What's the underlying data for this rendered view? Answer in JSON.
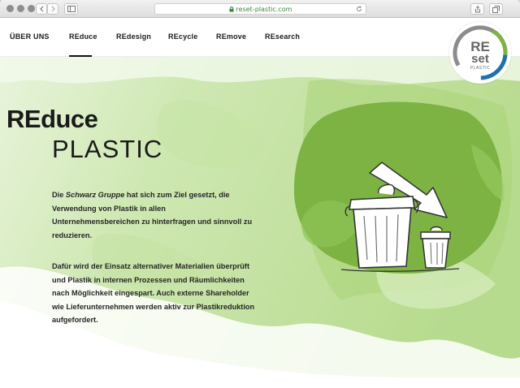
{
  "browser": {
    "url": "reset-plastic.com"
  },
  "nav": {
    "items": [
      {
        "label": "ÜBER UNS"
      },
      {
        "label": "REduce"
      },
      {
        "label": "REdesign"
      },
      {
        "label": "REcycle"
      },
      {
        "label": "REmove"
      },
      {
        "label": "REsearch"
      }
    ],
    "active": "REduce"
  },
  "logo": {
    "line1": "RE",
    "line2": "set",
    "line3": "PLASTIC"
  },
  "hero": {
    "title_bold": "REduce",
    "title_light": "PLASTIC",
    "p1_prefix": "Die ",
    "p1_emph": "Schwarz Gruppe",
    "p1_rest": " hat sich zum Ziel gesetzt, die Verwendung von Plastik in allen Unternehmensbereichen zu hinterfragen und sinnvoll zu reduzieren.",
    "p2": "Dafür wird der Einsatz alternativer Materialien überprüft und Plastik in internen Prozessen und Räumlichkeiten nach Möglichkeit eingespart. Auch externe Shareholder wie Lieferunternehmen werden aktiv zur Plastikreduktion aufgefordert."
  },
  "colors": {
    "accent_green": "#7cb342",
    "light_green": "#b9dc8c",
    "logo_blue": "#1f6fb5"
  }
}
